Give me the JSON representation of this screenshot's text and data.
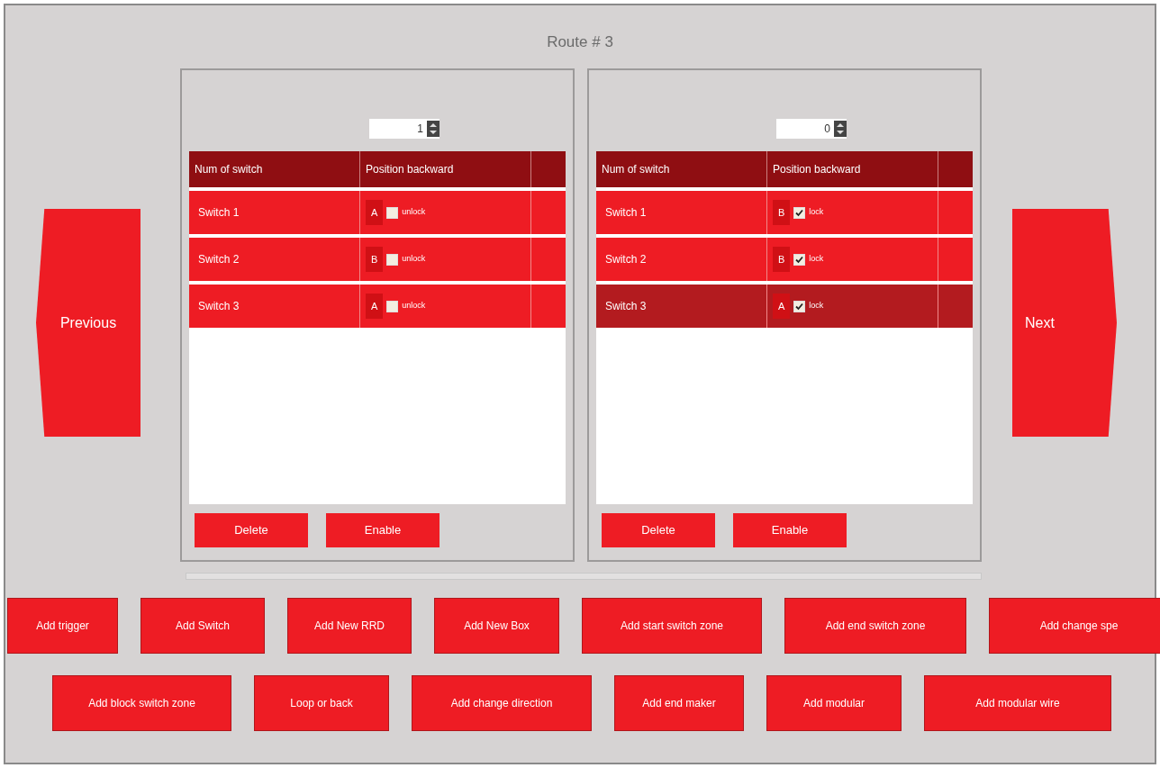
{
  "title": "Route # 3",
  "previous_button": "Previous",
  "next_button": "Next",
  "panels": [
    {
      "spinner": "1",
      "columns": [
        "Num of switch",
        "Position backward"
      ],
      "rows": [
        {
          "name": "Switch 1",
          "position": "A",
          "checked": false,
          "state": "unlock",
          "selected": false
        },
        {
          "name": "Switch 2",
          "position": "B",
          "checked": false,
          "state": "unlock",
          "selected": false
        },
        {
          "name": "Switch 3",
          "position": "A",
          "checked": false,
          "state": "unlock",
          "selected": false
        }
      ],
      "buttons": [
        "Delete",
        "Enable"
      ]
    },
    {
      "spinner": "0",
      "columns": [
        "Num of switch",
        "Position backward"
      ],
      "rows": [
        {
          "name": "Switch 1",
          "position": "B",
          "checked": true,
          "state": "lock",
          "selected": false
        },
        {
          "name": "Switch 2",
          "position": "B",
          "checked": true,
          "state": "lock",
          "selected": false
        },
        {
          "name": "Switch 3",
          "position": "A",
          "checked": true,
          "state": "lock",
          "selected": true
        }
      ],
      "buttons": [
        "Delete",
        "Enable"
      ]
    }
  ],
  "action_rows": [
    [
      "Add trigger",
      "Add Switch",
      "Add New RRD",
      "Add New Box",
      "Add start switch zone",
      "Add end switch zone",
      "Add change spe"
    ],
    [
      "Add block switch zone",
      "Loop or back",
      "Add change direction",
      "Add end maker",
      "Add modular",
      "Add modular wire"
    ]
  ]
}
